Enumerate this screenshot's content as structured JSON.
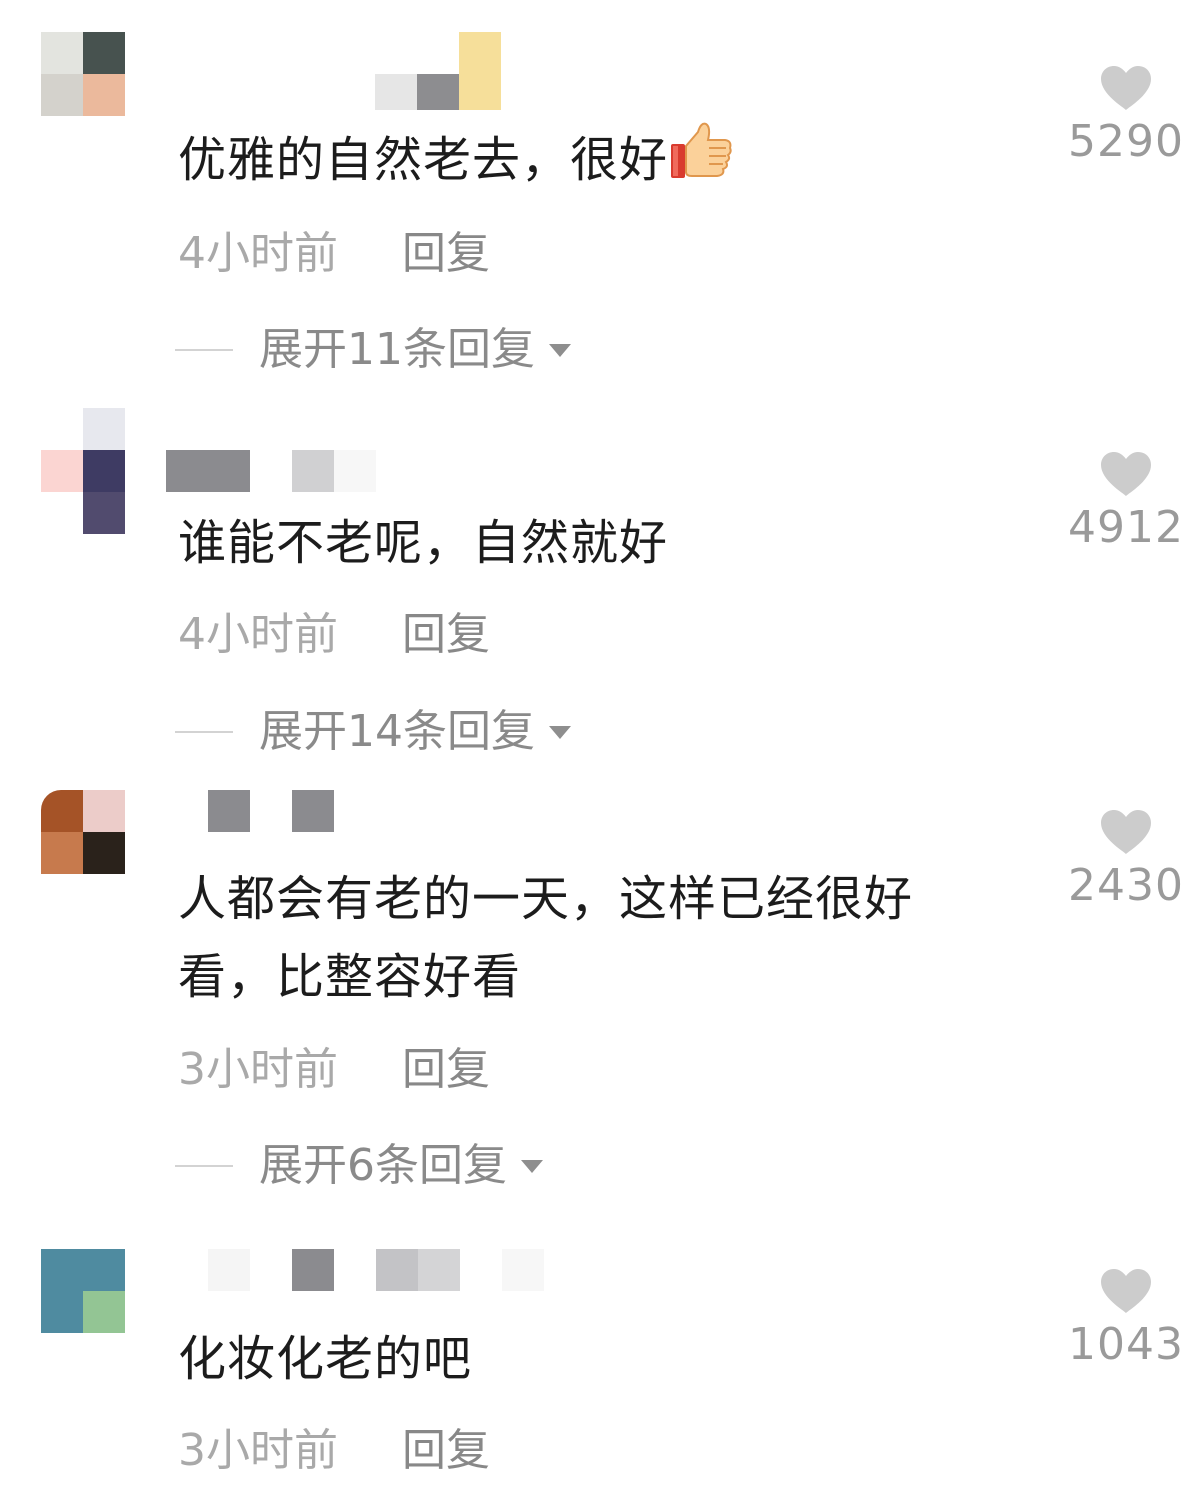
{
  "colors": {
    "text": "#1c1c1c",
    "meta": "#a9a9a9",
    "reply": "#888888",
    "heart": "#cccccc"
  },
  "icons": {
    "like": "heart-icon",
    "expand": "caret-down-icon",
    "emoji": "thumbs-up-emoji"
  },
  "comments": [
    {
      "text": "优雅的自然老去，很好",
      "emoji": "👍",
      "time": "4小时前",
      "reply_label": "回复",
      "expand_label": "展开11条回复",
      "likes": "5290"
    },
    {
      "text": "谁能不老呢，自然就好",
      "time": "4小时前",
      "reply_label": "回复",
      "expand_label": "展开14条回复",
      "likes": "4912"
    },
    {
      "text_line1": "人都会有老的一天，这样已经很好",
      "text_line2": "看，比整容好看",
      "time": "3小时前",
      "reply_label": "回复",
      "expand_label": "展开6条回复",
      "likes": "2430"
    },
    {
      "text": "化妆化老的吧",
      "time": "3小时前",
      "reply_label": "回复",
      "likes": "1043"
    }
  ]
}
